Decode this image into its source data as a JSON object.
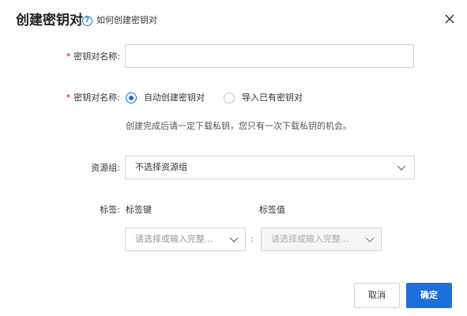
{
  "dialog": {
    "title": "创建密钥对",
    "help_text": "如何创建密钥对",
    "close_icon": "close-icon"
  },
  "form": {
    "name_field": {
      "required_mark": "*",
      "label": "密钥对名称:",
      "value": "",
      "placeholder": ""
    },
    "method_field": {
      "required_mark": "*",
      "label": "密钥对名称:",
      "options": [
        {
          "label": "自动创建密钥对",
          "selected": true
        },
        {
          "label": "导入已有密钥对",
          "selected": false
        }
      ],
      "hint": "创建完成后请一定下载私钥，您只有一次下载私钥的机会。"
    },
    "resource_group": {
      "label": "资源组:",
      "selected": "不选择资源组"
    },
    "tags": {
      "label": "标签:",
      "key_header": "标签键",
      "value_header": "标签值",
      "key_placeholder": "请选择或输入完整...",
      "separator": ":",
      "value_placeholder": "请选择或输入完整..."
    }
  },
  "footer": {
    "cancel_label": "取消",
    "ok_label": "确定"
  },
  "colors": {
    "accent": "#1e6fd9",
    "required": "#d0021b",
    "border": "#cfd3d8"
  }
}
